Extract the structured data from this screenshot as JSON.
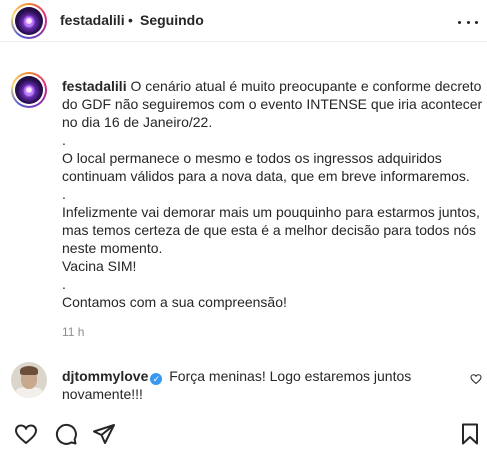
{
  "header": {
    "username": "festadalili",
    "separator": "•",
    "follow_status": "Seguindo",
    "more_icon": "more-horizontal-icon"
  },
  "caption": {
    "username": "festadalili",
    "lines": [
      "O cenário atual é muito preocupante e conforme decreto",
      "do GDF não seguiremos com o evento INTENSE que iria acontecer",
      "no dia 16 de Janeiro/22.",
      ".",
      "O local permanece o mesmo e todos os ingressos adquiridos",
      "continuam válidos para a nova data, que em breve informaremos.",
      ".",
      "Infelizmente vai demorar mais um pouquinho para estarmos juntos,",
      "mas temos certeza de que esta é a melhor decisão para todos nós",
      "neste momento.",
      "Vacina SIM!",
      ".",
      "Contamos com a sua compreensão!"
    ],
    "time": "11 h"
  },
  "comment": {
    "username": "djtommylove",
    "verified_icon": "verified-badge-icon",
    "text_line1": "Força meninas! Logo estaremos juntos",
    "text_line2": "novamente!!!",
    "like_icon": "heart-icon"
  },
  "actions": {
    "like_icon": "heart-icon",
    "comment_icon": "comment-icon",
    "share_icon": "share-icon",
    "save_icon": "bookmark-icon"
  }
}
